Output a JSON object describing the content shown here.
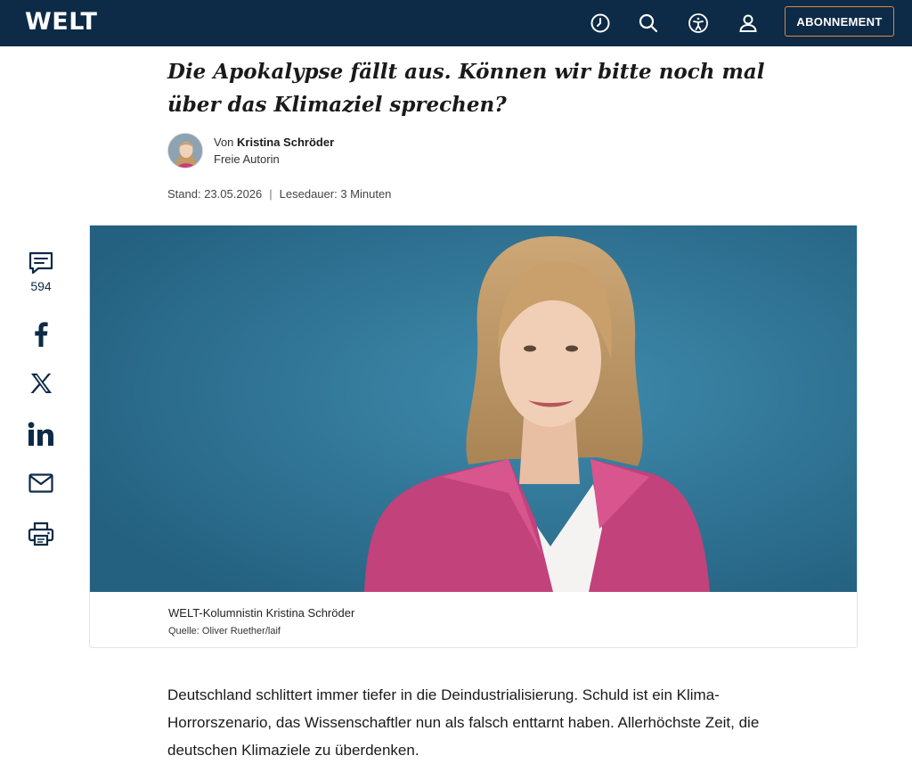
{
  "header": {
    "logo_text": "WELT",
    "subscribe_label": "ABONNEMENT",
    "icons": [
      "history-icon",
      "search-icon",
      "accessibility-icon",
      "user-icon"
    ],
    "bg_color": "#0d2a46",
    "accent_color": "#e08a3c"
  },
  "article": {
    "headline": "Die Apokalypse fällt aus. Können wir bitte noch mal über das Klimaziel sprechen?",
    "author_prefix": "Von",
    "author_name": "Kristina Schröder",
    "author_role": "Freie Autorin",
    "date_label": "Stand: 23.05.2026",
    "read_time": "Lesedauer: 3 Minuten",
    "lead": "Deutschland schlittert immer tiefer in die Deindustrialisierung. Schuld ist ein Klima-Horrorszenario, das Wissenschaftler nun als falsch enttarnt haben. Allerhöchste Zeit, die deutschen Klimaziele zu überdenken."
  },
  "image": {
    "caption": "WELT-Kolumnistin Kristina Schröder",
    "credit": "Quelle: Oliver Ruether/laif"
  },
  "share": {
    "comment_count": "594",
    "icons": [
      "comment-icon",
      "facebook-icon",
      "x-icon",
      "linkedin-icon",
      "mail-icon",
      "print-icon"
    ]
  }
}
